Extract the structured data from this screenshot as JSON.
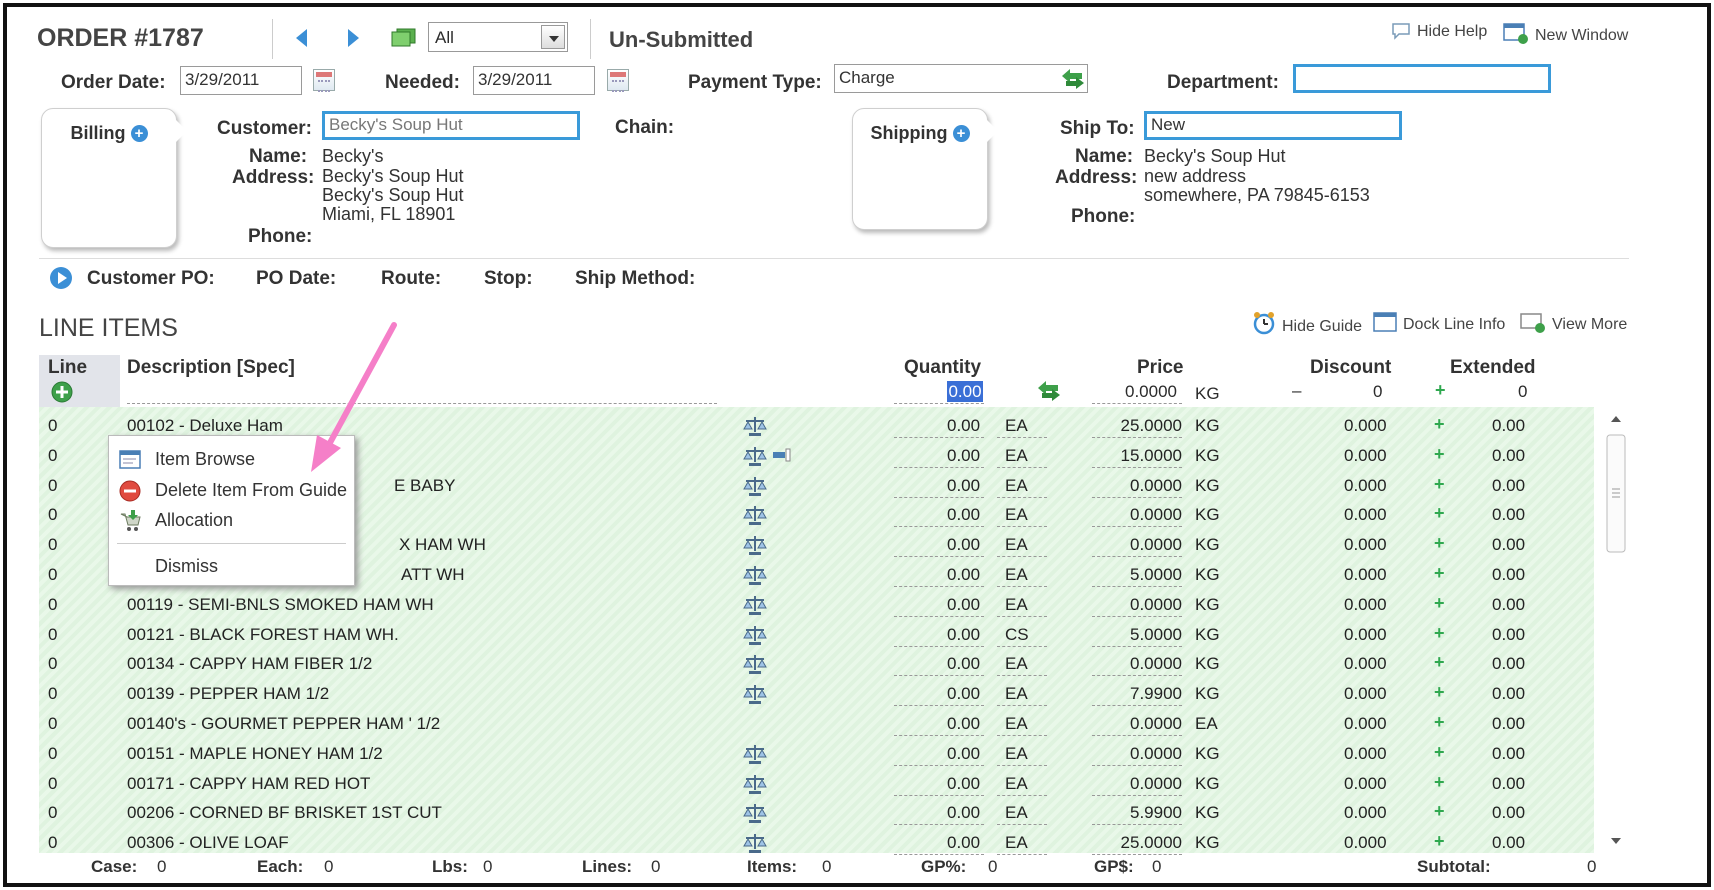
{
  "header": {
    "order_title": "ORDER #1787",
    "filter_value": "All",
    "status": "Un-Submitted",
    "hide_help": "Hide Help",
    "new_window": "New Window"
  },
  "order": {
    "order_date_label": "Order Date:",
    "order_date": "3/29/2011",
    "needed_label": "Needed:",
    "needed_date": "3/29/2011",
    "payment_type_label": "Payment Type:",
    "payment_type": "Charge",
    "department_label": "Department:",
    "department": ""
  },
  "billing": {
    "tab_label": "Billing",
    "customer_label": "Customer:",
    "customer": "Becky's Soup Hut",
    "chain_label": "Chain:",
    "name_label": "Name:",
    "name": "Becky's",
    "address_label": "Address:",
    "address_lines": [
      "Becky's Soup Hut",
      "Becky's Soup Hut",
      "Miami, FL 18901"
    ],
    "phone_label": "Phone:"
  },
  "shipping": {
    "tab_label": "Shipping",
    "ship_to_label": "Ship To:",
    "ship_to": "New",
    "name_label": "Name:",
    "name": "Becky's Soup Hut",
    "address_label": "Address:",
    "address_lines": [
      "new address",
      "somewhere, PA 79845-6153"
    ],
    "phone_label": "Phone:"
  },
  "po_bar": {
    "customer_po": "Customer PO:",
    "po_date": "PO Date:",
    "route": "Route:",
    "stop": "Stop:",
    "ship_method": "Ship Method:"
  },
  "line_items": {
    "title": "LINE ITEMS",
    "hide_guide": "Hide Guide",
    "dock_line_info": "Dock Line Info",
    "view_more": "View More",
    "columns": {
      "line": "Line",
      "description": "Description [Spec]",
      "quantity": "Quantity",
      "price": "Price",
      "discount": "Discount",
      "extended": "Extended"
    },
    "entry_row": {
      "quantity": "0.00",
      "price": "0.0000",
      "price_unit": "KG",
      "discount_sign": "–",
      "discount": "0",
      "extended": "0"
    },
    "rows": [
      {
        "line": "0",
        "desc": "00102 - Deluxe Ham",
        "scale": true,
        "qty": "0.00",
        "uom": "EA",
        "price": "25.0000",
        "punit": "KG",
        "disc": "0.000",
        "ext": "0.00"
      },
      {
        "line": "0",
        "desc": "",
        "scale": true,
        "qty": "0.00",
        "uom": "EA",
        "price": "15.0000",
        "punit": "KG",
        "disc": "0.000",
        "ext": "0.00"
      },
      {
        "line": "0",
        "desc": "E BABY",
        "scale": true,
        "qty": "0.00",
        "uom": "EA",
        "price": "0.0000",
        "punit": "KG",
        "disc": "0.000",
        "ext": "0.00"
      },
      {
        "line": "0",
        "desc": "",
        "scale": true,
        "qty": "0.00",
        "uom": "EA",
        "price": "0.0000",
        "punit": "KG",
        "disc": "0.000",
        "ext": "0.00"
      },
      {
        "line": "0",
        "desc": "X HAM WH",
        "scale": true,
        "qty": "0.00",
        "uom": "EA",
        "price": "0.0000",
        "punit": "KG",
        "disc": "0.000",
        "ext": "0.00"
      },
      {
        "line": "0",
        "desc": "ATT WH",
        "scale": true,
        "qty": "0.00",
        "uom": "EA",
        "price": "5.0000",
        "punit": "KG",
        "disc": "0.000",
        "ext": "0.00"
      },
      {
        "line": "0",
        "desc": "00119 - SEMI-BNLS SMOKED HAM WH",
        "scale": true,
        "qty": "0.00",
        "uom": "EA",
        "price": "0.0000",
        "punit": "KG",
        "disc": "0.000",
        "ext": "0.00"
      },
      {
        "line": "0",
        "desc": "00121 - BLACK FOREST HAM WH.",
        "scale": true,
        "qty": "0.00",
        "uom": "CS",
        "price": "5.0000",
        "punit": "KG",
        "disc": "0.000",
        "ext": "0.00"
      },
      {
        "line": "0",
        "desc": "00134 - CAPPY HAM FIBER 1/2",
        "scale": true,
        "qty": "0.00",
        "uom": "EA",
        "price": "0.0000",
        "punit": "KG",
        "disc": "0.000",
        "ext": "0.00"
      },
      {
        "line": "0",
        "desc": "00139 - PEPPER HAM 1/2",
        "scale": true,
        "qty": "0.00",
        "uom": "EA",
        "price": "7.9900",
        "punit": "KG",
        "disc": "0.000",
        "ext": "0.00"
      },
      {
        "line": "0",
        "desc": "00140's - GOURMET PEPPER HAM ' 1/2",
        "scale": false,
        "qty": "0.00",
        "uom": "EA",
        "price": "0.0000",
        "punit": "EA",
        "disc": "0.000",
        "ext": "0.00"
      },
      {
        "line": "0",
        "desc": "00151 - MAPLE HONEY HAM 1/2",
        "scale": true,
        "qty": "0.00",
        "uom": "EA",
        "price": "0.0000",
        "punit": "KG",
        "disc": "0.000",
        "ext": "0.00"
      },
      {
        "line": "0",
        "desc": "00171 - CAPPY HAM RED HOT",
        "scale": true,
        "qty": "0.00",
        "uom": "EA",
        "price": "0.0000",
        "punit": "KG",
        "disc": "0.000",
        "ext": "0.00"
      },
      {
        "line": "0",
        "desc": "00206 - CORNED BF BRISKET 1ST CUT",
        "scale": true,
        "qty": "0.00",
        "uom": "EA",
        "price": "5.9900",
        "punit": "KG",
        "disc": "0.000",
        "ext": "0.00"
      },
      {
        "line": "0",
        "desc": "00306 - OLIVE LOAF",
        "scale": true,
        "qty": "0.00",
        "uom": "EA",
        "price": "25.0000",
        "punit": "KG",
        "disc": "0.000",
        "ext": "0.00"
      }
    ]
  },
  "context_menu": {
    "item_browse": "Item Browse",
    "delete_item": "Delete Item From Guide",
    "allocation": "Allocation",
    "dismiss": "Dismiss"
  },
  "footer": {
    "case_label": "Case:",
    "case": "0",
    "each_label": "Each:",
    "each": "0",
    "lbs_label": "Lbs:",
    "lbs": "0",
    "lines_label": "Lines:",
    "lines": "0",
    "items_label": "Items:",
    "items": "0",
    "gp_pct_label": "GP%:",
    "gp_pct": "0",
    "gp_dollar_label": "GP$:",
    "gp_dollar": "0",
    "subtotal_label": "Subtotal:",
    "subtotal": "0"
  },
  "colors": {
    "accent_blue": "#3a9ad9",
    "grid_green": "#dff3df",
    "annotation_pink": "#f57fc8"
  }
}
